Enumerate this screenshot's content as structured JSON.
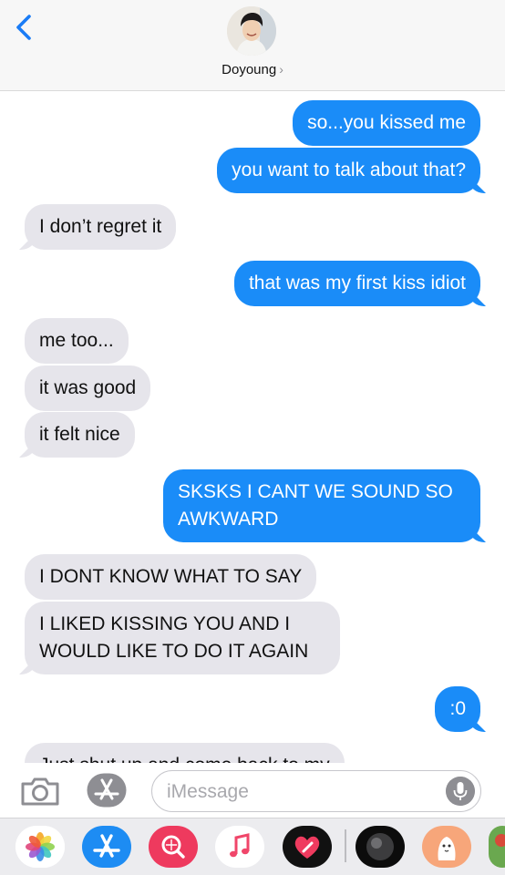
{
  "header": {
    "contact_name": "Doyoung",
    "chevron": "›"
  },
  "messages": [
    {
      "side": "out",
      "text": "so...you kissed me"
    },
    {
      "side": "out",
      "text": "you want to talk about that?"
    },
    {
      "side": "in",
      "text": "I don’t regret it"
    },
    {
      "side": "out",
      "text": "that was my first kiss idiot"
    },
    {
      "side": "in",
      "text": "me too..."
    },
    {
      "side": "in",
      "text": "it was good"
    },
    {
      "side": "in",
      "text": "it felt nice"
    },
    {
      "side": "out",
      "lines": [
        "SKSKS I CANT WE SOUND SO",
        "AWKWARD"
      ]
    },
    {
      "side": "in",
      "text": "I DONT KNOW WHAT TO SAY"
    },
    {
      "side": "in",
      "lines": [
        "I LIKED KISSING YOU AND I",
        "WOULD LIKE TO DO IT AGAIN"
      ]
    },
    {
      "side": "out",
      "text": ":0"
    },
    {
      "side": "in",
      "text": "Just shut up and come back to my"
    }
  ],
  "input": {
    "placeholder": "iMessage"
  },
  "icons": {
    "back": "chevron-left-icon",
    "camera": "camera-icon",
    "appstore": "app-store-icon",
    "mic": "microphone-icon"
  },
  "drawer_apps": [
    "photos-icon",
    "app-store-icon",
    "web-images-icon",
    "music-icon",
    "digital-touch-icon",
    "animoji-icon",
    "sticker-icon",
    "partial-app-icon"
  ],
  "colors": {
    "outgoing_bubble": "#1a8cf8",
    "incoming_bubble": "#e6e5eb",
    "ios_blue": "#1a7cf6"
  }
}
